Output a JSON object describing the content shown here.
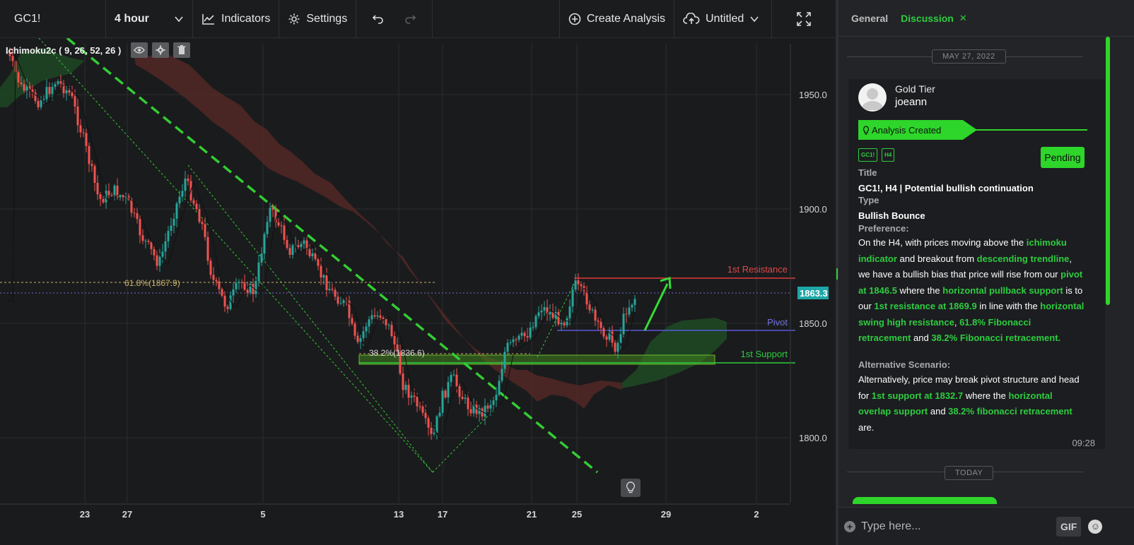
{
  "toolbar": {
    "symbol": "GC1!",
    "timeframe": "4 hour",
    "indicators_label": "Indicators",
    "settings_label": "Settings",
    "create_analysis_label": "Create Analysis",
    "layout_name": "Untitled"
  },
  "chart": {
    "indicator_label": "Ichimoku2c ( 9, 26, 52, 26 )",
    "price_ticks": [
      "1950.0",
      "1900.0",
      "1850.0",
      "1800.0"
    ],
    "date_ticks": [
      "23",
      "27",
      "5",
      "13",
      "17",
      "21",
      "25",
      "29",
      "2"
    ],
    "current_price": "1863.3",
    "annotations": {
      "resistance": "1st Resistance",
      "pivot": "Pivot",
      "support": "1st Support",
      "fib_618": "61.8%(1867.9)",
      "fib_382": "38.2%(1836.6)"
    }
  },
  "sidebar": {
    "tabs": [
      {
        "label": "General",
        "active": false
      },
      {
        "label": "Discussion",
        "active": true
      }
    ],
    "date_separator_1": "MAY 27, 2022",
    "date_separator_2": "TODAY",
    "message": {
      "tier": "Gold Tier",
      "username": "joeann",
      "status": "Analysis Created",
      "tags": [
        "GC1!",
        "H4"
      ],
      "badge": "Pending",
      "title_label": "Title",
      "title_value": "GC1!, H4 | Potential bullish continuation",
      "type_label": "Type",
      "type_value": "Bullish Bounce",
      "preference_label": "Preference:",
      "preference_text": [
        {
          "t": "On the H4, with prices moving above the ",
          "hl": false
        },
        {
          "t": "ichimoku indicator",
          "hl": true
        },
        {
          "t": " and breakout from ",
          "hl": false
        },
        {
          "t": "descending trendline",
          "hl": true
        },
        {
          "t": ", we have a bullish bias that price will rise from our ",
          "hl": false
        },
        {
          "t": "pivot at 1846.5",
          "hl": true
        },
        {
          "t": " where the ",
          "hl": false
        },
        {
          "t": "horizontal pullback support",
          "hl": true
        },
        {
          "t": " is to our ",
          "hl": false
        },
        {
          "t": "1st resistance at 1869.9",
          "hl": true
        },
        {
          "t": " in line with the ",
          "hl": false
        },
        {
          "t": "horizontal swing high resistance",
          "hl": true
        },
        {
          "t": ", ",
          "hl": false
        },
        {
          "t": "61.8% Fibonacci retracement",
          "hl": true
        },
        {
          "t": " and ",
          "hl": false
        },
        {
          "t": "38.2% Fibonacci retracement.",
          "hl": true
        }
      ],
      "alt_label": "Alternative Scenario:",
      "alt_text": [
        {
          "t": "Alternatively, price may break pivot structure and head for ",
          "hl": false
        },
        {
          "t": "1st support at 1832.7",
          "hl": true
        },
        {
          "t": " where the ",
          "hl": false
        },
        {
          "t": "horizontal overlap support",
          "hl": true
        },
        {
          "t": " and ",
          "hl": false
        },
        {
          "t": "38.2% fibonacci retracement",
          "hl": true
        },
        {
          "t": " are.",
          "hl": false
        }
      ],
      "time": "09:28"
    },
    "composer": {
      "placeholder": "Type here...",
      "gif_label": "GIF"
    }
  }
}
